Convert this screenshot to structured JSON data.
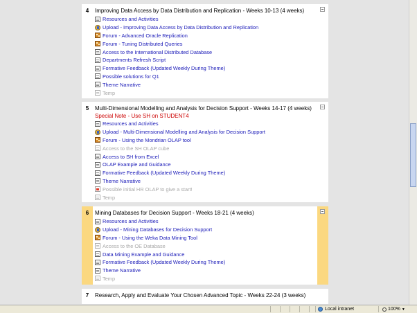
{
  "sections": [
    {
      "number": "4",
      "title": "Improving Data Access by Data Distribution and Replication - Weeks 10-13 (4 weeks)",
      "activities": [
        {
          "label": "Resources and Activities",
          "icon": "page-icon"
        },
        {
          "label": "Upload - Improving Data Access by Data Distribution and Replication",
          "icon": "upload-icon"
        },
        {
          "label": "Forum - Advanced Oracle Replication",
          "icon": "forum-icon"
        },
        {
          "label": "Forum - Tuning Distributed Queries",
          "icon": "forum-icon"
        },
        {
          "label": "Access to the International Distributed Database",
          "icon": "page-icon"
        },
        {
          "label": "Departments Refresh Script",
          "icon": "page-icon"
        },
        {
          "label": "Formative Feedback (Updated Weekly During Theme)",
          "icon": "page-icon"
        },
        {
          "label": "Possible solutions for Q1",
          "icon": "page-icon"
        },
        {
          "label": "Theme Narrative",
          "icon": "page-icon"
        },
        {
          "label": "Temp",
          "icon": "page-icon",
          "hidden": true
        }
      ]
    },
    {
      "number": "5",
      "title": "Multi-Dimensional Modelling and Analysis for Decision Support - Weeks 14-17  (4 weeks)",
      "special_note": "Special Note - Use SH on STUDENT4",
      "activities": [
        {
          "label": "Resources and Activities",
          "icon": "page-icon"
        },
        {
          "label": "Upload - Multi-Dimensional Modelling and Analysis for Decision Support",
          "icon": "upload-icon"
        },
        {
          "label": "Forum - Using the Mondrian OLAP tool",
          "icon": "forum-icon"
        },
        {
          "label": "Access to the SH OLAP cube",
          "icon": "page-icon",
          "hidden": true
        },
        {
          "label": "Access to SH from Excel",
          "icon": "page-icon"
        },
        {
          "label": "OLAP Example and Guidance",
          "icon": "page-icon"
        },
        {
          "label": "Formative Feedback (Updated Weekly During Theme)",
          "icon": "page-icon"
        },
        {
          "label": "Theme Narrative",
          "icon": "page-icon"
        },
        {
          "label": "Possible initial HR OLAP to give a start!",
          "icon": "pdf-icon",
          "hidden": true
        },
        {
          "label": "Temp",
          "icon": "page-icon",
          "hidden": true
        }
      ]
    },
    {
      "number": "6",
      "title": "Mining Databases for Decision Support - Weeks 18-21 (4 weeks)",
      "current": true,
      "activities": [
        {
          "label": "Resources and Activities",
          "icon": "page-icon"
        },
        {
          "label": "Upload - Mining Databases for Decision Support",
          "icon": "upload-icon"
        },
        {
          "label": "Forum - Using the Weka Data Mining Tool",
          "icon": "forum-icon"
        },
        {
          "label": "Access to the OE Database",
          "icon": "page-icon",
          "hidden": true
        },
        {
          "label": "Data Mining Example and Guidance",
          "icon": "page-icon"
        },
        {
          "label": "Formative Feedback (Updated Weekly During Theme)",
          "icon": "page-icon"
        },
        {
          "label": "Theme Narrative",
          "icon": "page-icon"
        },
        {
          "label": "Temp",
          "icon": "page-icon",
          "hidden": true
        }
      ]
    },
    {
      "number": "7",
      "title": "Research, Apply and Evaluate Your Chosen Advanced Topic - Weeks 22-24 (3 weeks)",
      "activities": []
    }
  ],
  "statusbar": {
    "zone": "Local intranet",
    "zoom": "100%"
  },
  "colors": {
    "link": "#1a1ab8",
    "hidden_link": "#a8a8a8",
    "current_highlight": "#fbd880",
    "special_note": "#cc0000",
    "page_background": "#e4e4e4"
  }
}
